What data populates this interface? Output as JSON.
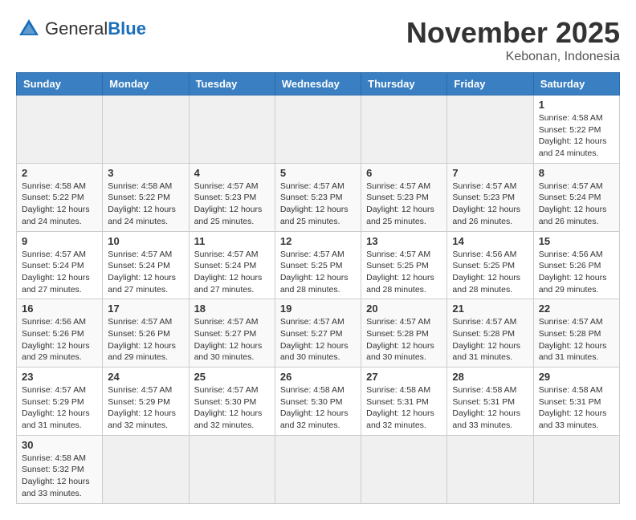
{
  "header": {
    "logo_general": "General",
    "logo_blue": "Blue",
    "month": "November 2025",
    "location": "Kebonan, Indonesia"
  },
  "weekdays": [
    "Sunday",
    "Monday",
    "Tuesday",
    "Wednesday",
    "Thursday",
    "Friday",
    "Saturday"
  ],
  "days": {
    "1": {
      "sunrise": "4:58 AM",
      "sunset": "5:22 PM",
      "daylight": "12 hours and 24 minutes."
    },
    "2": {
      "sunrise": "4:58 AM",
      "sunset": "5:22 PM",
      "daylight": "12 hours and 24 minutes."
    },
    "3": {
      "sunrise": "4:58 AM",
      "sunset": "5:22 PM",
      "daylight": "12 hours and 24 minutes."
    },
    "4": {
      "sunrise": "4:57 AM",
      "sunset": "5:23 PM",
      "daylight": "12 hours and 25 minutes."
    },
    "5": {
      "sunrise": "4:57 AM",
      "sunset": "5:23 PM",
      "daylight": "12 hours and 25 minutes."
    },
    "6": {
      "sunrise": "4:57 AM",
      "sunset": "5:23 PM",
      "daylight": "12 hours and 25 minutes."
    },
    "7": {
      "sunrise": "4:57 AM",
      "sunset": "5:23 PM",
      "daylight": "12 hours and 26 minutes."
    },
    "8": {
      "sunrise": "4:57 AM",
      "sunset": "5:24 PM",
      "daylight": "12 hours and 26 minutes."
    },
    "9": {
      "sunrise": "4:57 AM",
      "sunset": "5:24 PM",
      "daylight": "12 hours and 27 minutes."
    },
    "10": {
      "sunrise": "4:57 AM",
      "sunset": "5:24 PM",
      "daylight": "12 hours and 27 minutes."
    },
    "11": {
      "sunrise": "4:57 AM",
      "sunset": "5:24 PM",
      "daylight": "12 hours and 27 minutes."
    },
    "12": {
      "sunrise": "4:57 AM",
      "sunset": "5:25 PM",
      "daylight": "12 hours and 28 minutes."
    },
    "13": {
      "sunrise": "4:57 AM",
      "sunset": "5:25 PM",
      "daylight": "12 hours and 28 minutes."
    },
    "14": {
      "sunrise": "4:56 AM",
      "sunset": "5:25 PM",
      "daylight": "12 hours and 28 minutes."
    },
    "15": {
      "sunrise": "4:56 AM",
      "sunset": "5:26 PM",
      "daylight": "12 hours and 29 minutes."
    },
    "16": {
      "sunrise": "4:56 AM",
      "sunset": "5:26 PM",
      "daylight": "12 hours and 29 minutes."
    },
    "17": {
      "sunrise": "4:57 AM",
      "sunset": "5:26 PM",
      "daylight": "12 hours and 29 minutes."
    },
    "18": {
      "sunrise": "4:57 AM",
      "sunset": "5:27 PM",
      "daylight": "12 hours and 30 minutes."
    },
    "19": {
      "sunrise": "4:57 AM",
      "sunset": "5:27 PM",
      "daylight": "12 hours and 30 minutes."
    },
    "20": {
      "sunrise": "4:57 AM",
      "sunset": "5:28 PM",
      "daylight": "12 hours and 30 minutes."
    },
    "21": {
      "sunrise": "4:57 AM",
      "sunset": "5:28 PM",
      "daylight": "12 hours and 31 minutes."
    },
    "22": {
      "sunrise": "4:57 AM",
      "sunset": "5:28 PM",
      "daylight": "12 hours and 31 minutes."
    },
    "23": {
      "sunrise": "4:57 AM",
      "sunset": "5:29 PM",
      "daylight": "12 hours and 31 minutes."
    },
    "24": {
      "sunrise": "4:57 AM",
      "sunset": "5:29 PM",
      "daylight": "12 hours and 32 minutes."
    },
    "25": {
      "sunrise": "4:57 AM",
      "sunset": "5:30 PM",
      "daylight": "12 hours and 32 minutes."
    },
    "26": {
      "sunrise": "4:58 AM",
      "sunset": "5:30 PM",
      "daylight": "12 hours and 32 minutes."
    },
    "27": {
      "sunrise": "4:58 AM",
      "sunset": "5:31 PM",
      "daylight": "12 hours and 32 minutes."
    },
    "28": {
      "sunrise": "4:58 AM",
      "sunset": "5:31 PM",
      "daylight": "12 hours and 33 minutes."
    },
    "29": {
      "sunrise": "4:58 AM",
      "sunset": "5:31 PM",
      "daylight": "12 hours and 33 minutes."
    },
    "30": {
      "sunrise": "4:58 AM",
      "sunset": "5:32 PM",
      "daylight": "12 hours and 33 minutes."
    }
  }
}
